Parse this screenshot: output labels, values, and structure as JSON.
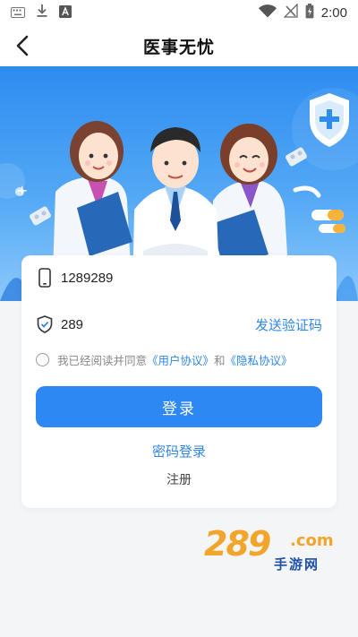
{
  "status_bar": {
    "time": "2:00",
    "left_icons": [
      "keyboard-icon",
      "download-icon",
      "font-a-icon"
    ],
    "right_icons": [
      "wifi-icon",
      "no-signal-icon",
      "battery-charging-icon"
    ]
  },
  "app_bar": {
    "title": "医事无忧",
    "back_icon": "chevron-left-icon"
  },
  "hero": {
    "illustration": "three-doctors-illustration",
    "decorations": [
      "shield-plus-icon",
      "pill-blister-icon",
      "capsule-icon"
    ]
  },
  "login_form": {
    "phone_icon": "phone-icon",
    "phone_value": "1289289",
    "code_icon": "shield-check-icon",
    "code_value": "289",
    "send_code_label": "发送验证码",
    "agreement": {
      "prefix": "我已经阅读并同意",
      "user_agreement": "《用户协议》",
      "connector": "和",
      "privacy_policy": "《隐私协议》"
    },
    "login_label": "登录",
    "password_login_label": "密码登录",
    "register_label": "注册"
  },
  "watermark": {
    "main": "289",
    "domain": ".com",
    "sub": "手游网"
  },
  "colors": {
    "primary": "#2d88f4",
    "link": "#2f86e8",
    "hero_top": "#2e8cf0",
    "background": "#f4f5f7",
    "watermark_orange": "#f3a42b",
    "watermark_blue": "#1f4fa8"
  }
}
